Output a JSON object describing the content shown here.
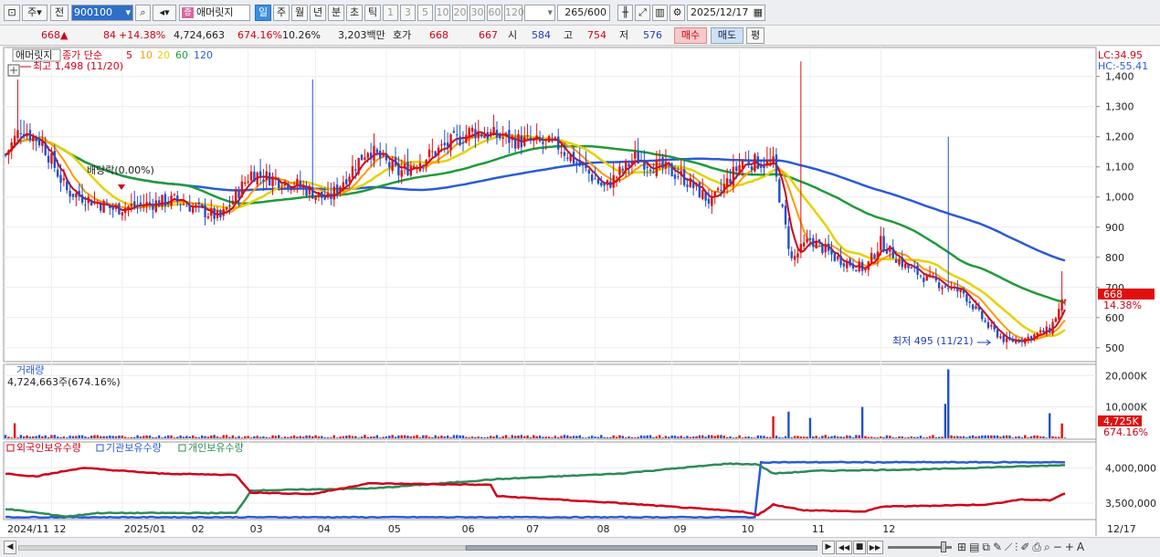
{
  "toolbar": {
    "market": "주",
    "prev": "전",
    "code": "900100",
    "tag": "증",
    "name": "애머릿지",
    "periods": [
      "일",
      "주",
      "월",
      "년",
      "분",
      "초",
      "틱"
    ],
    "active_period": "일",
    "intervals": [
      "1",
      "3",
      "5",
      "10",
      "20",
      "30",
      "60",
      "120"
    ],
    "count": "265",
    "count_total": "/600",
    "date": "2025/12/17"
  },
  "quote": {
    "price": "668",
    "change_sign": "▲",
    "change": "84",
    "change_pct": "+14.38%",
    "volume": "4,724,663",
    "volume_ratio": "674.16%",
    "turnover": "10.26%",
    "amount": "3,203백만",
    "bid_label": "호가",
    "ask": "668",
    "bid": "667",
    "open_label": "시",
    "open": "584",
    "high_label": "고",
    "high": "754",
    "low_label": "저",
    "low": "576",
    "buy_label": "매수",
    "sell_label": "매도",
    "avg_label": "평"
  },
  "price_panel": {
    "stock_name": "애머릿지",
    "ma_label": "종가 단순",
    "ma_periods": [
      {
        "label": "5",
        "color": "#d0021b"
      },
      {
        "label": "10",
        "color": "#ff9900"
      },
      {
        "label": "20",
        "color": "#e6d200"
      },
      {
        "label": "60",
        "color": "#1f9a3a"
      },
      {
        "label": "120",
        "color": "#2a5bd7"
      }
    ],
    "lc": "LC:34.95",
    "hc": "HC:-55.41",
    "high_marker": "최고 1,498 (11/20)",
    "low_marker": "최저 495 (11/21)",
    "dividend": "배당락(0.00%)",
    "price_tag": "668",
    "price_tag_pct": "14.38%"
  },
  "volume_panel": {
    "title": "거래량",
    "value": "4,724,663주(674.16%)",
    "tag": "4,725K",
    "tag_pct": "674.16%"
  },
  "holding_panel": {
    "series": [
      {
        "label": "외국인보유수량",
        "color": "#d0021b"
      },
      {
        "label": "기관보유수량",
        "color": "#2a5bd7"
      },
      {
        "label": "개인보유수량",
        "color": "#2e8b57"
      }
    ]
  },
  "x_axis": {
    "labels": [
      "2024/11",
      "12",
      "2025/01",
      "02",
      "03",
      "04",
      "05",
      "06",
      "07",
      "08",
      "09",
      "10",
      "11",
      "12"
    ],
    "end_label": "12/17"
  },
  "chart_data": [
    {
      "type": "candlestick",
      "y_ticks": [
        1400,
        1300,
        1200,
        1100,
        1000,
        900,
        800,
        700,
        600,
        500
      ],
      "y_tick_labels": [
        "1,400",
        "1,300",
        "1,200",
        "1,100",
        "1,000",
        "900",
        "800",
        "700",
        "600",
        "500"
      ],
      "ylim": [
        460,
        1490
      ],
      "closes_approx": [
        [
          0,
          1140
        ],
        [
          5,
          1230
        ],
        [
          12,
          1180
        ],
        [
          20,
          1020
        ],
        [
          35,
          960
        ],
        [
          55,
          990
        ],
        [
          70,
          930
        ],
        [
          80,
          1080
        ],
        [
          95,
          1040
        ],
        [
          105,
          990
        ],
        [
          118,
          1160
        ],
        [
          128,
          1080
        ],
        [
          140,
          1150
        ],
        [
          152,
          1220
        ],
        [
          165,
          1190
        ],
        [
          180,
          1170
        ],
        [
          195,
          1030
        ],
        [
          205,
          1130
        ],
        [
          220,
          1070
        ],
        [
          230,
          980
        ],
        [
          240,
          1120
        ],
        [
          250,
          1110
        ],
        [
          256,
          790
        ],
        [
          262,
          860
        ],
        [
          270,
          800
        ],
        [
          280,
          760
        ],
        [
          285,
          850
        ],
        [
          293,
          770
        ],
        [
          300,
          730
        ],
        [
          312,
          680
        ],
        [
          320,
          570
        ],
        [
          326,
          520
        ],
        [
          332,
          530
        ],
        [
          340,
          560
        ],
        [
          345,
          668
        ]
      ],
      "ma_last": {
        "5": 600,
        "10": 580,
        "20": 560,
        "60": 660,
        "120": 830
      }
    },
    {
      "type": "bar",
      "title": "거래량",
      "y_ticks": [
        20000,
        10000
      ],
      "y_tick_labels": [
        "20,000K",
        "10,000K"
      ],
      "ylim": [
        0,
        23000
      ],
      "spikes_approx": [
        [
          3,
          4800
        ],
        [
          250,
          7000
        ],
        [
          255,
          8500
        ],
        [
          262,
          6500
        ],
        [
          279,
          10000
        ],
        [
          306,
          11000
        ],
        [
          307,
          22000
        ],
        [
          340,
          8000
        ],
        [
          344,
          4725
        ]
      ]
    },
    {
      "type": "line",
      "y_ticks": [
        4000000,
        3500000
      ],
      "y_tick_labels": [
        "4,000,000",
        "3,500,000"
      ]
    }
  ],
  "footer": {
    "nav": [
      "▶",
      "◀◀",
      "■",
      "▶▶"
    ]
  }
}
